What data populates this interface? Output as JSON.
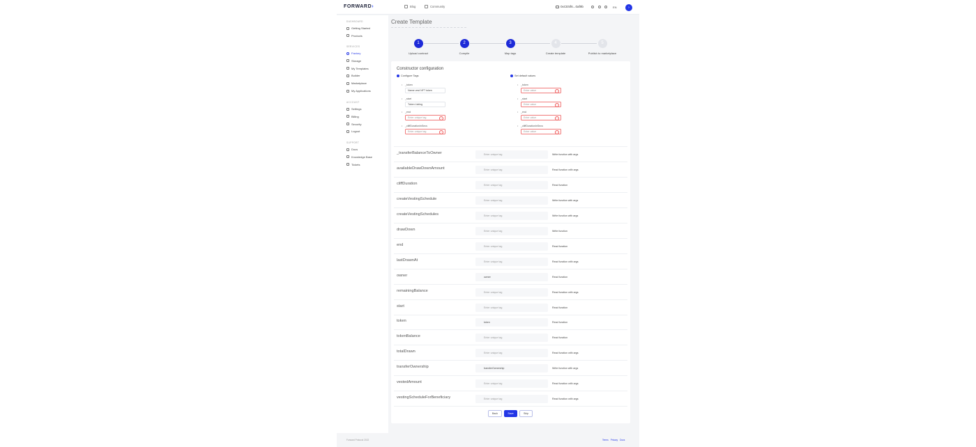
{
  "header": {
    "logo": "FORWARD",
    "nav": [
      {
        "label": "Blog",
        "icon": "book-icon"
      },
      {
        "label": "Community",
        "icon": "chat-icon"
      }
    ],
    "wallet": "0xCE5f6...0af9b",
    "language": "EN"
  },
  "sidebar": {
    "sections": [
      {
        "label": "DASHBOARD",
        "items": [
          {
            "label": "Getting Started",
            "icon": "rocket-icon",
            "active": false
          },
          {
            "label": "Products",
            "icon": "box-icon",
            "active": false
          }
        ]
      },
      {
        "label": "SERVICES",
        "items": [
          {
            "label": "Factory",
            "icon": "factory-icon",
            "active": true
          },
          {
            "label": "Storage",
            "icon": "storage-icon",
            "active": false
          },
          {
            "label": "My Templates",
            "icon": "template-icon",
            "active": false
          },
          {
            "label": "Builder",
            "icon": "builder-icon",
            "active": false
          },
          {
            "label": "Marketplace",
            "icon": "marketplace-icon",
            "active": false
          },
          {
            "label": "My Applications",
            "icon": "apps-icon",
            "active": false
          }
        ]
      },
      {
        "label": "ACCOUNT",
        "items": [
          {
            "label": "Settings",
            "icon": "gear-icon",
            "active": false
          },
          {
            "label": "Billing",
            "icon": "billing-icon",
            "active": false
          },
          {
            "label": "Security",
            "icon": "shield-icon",
            "active": false
          },
          {
            "label": "Logout",
            "icon": "logout-icon",
            "active": false
          }
        ]
      },
      {
        "label": "SUPPORT",
        "items": [
          {
            "label": "Docs",
            "icon": "docs-icon",
            "active": false
          },
          {
            "label": "Knowledge Base",
            "icon": "knowledge-icon",
            "active": false
          },
          {
            "label": "Tickets",
            "icon": "ticket-icon",
            "active": false
          }
        ]
      }
    ]
  },
  "page": {
    "title": "Create Template"
  },
  "steps": [
    {
      "number": "1",
      "label": "Upload contract",
      "state": "done"
    },
    {
      "number": "2",
      "label": "Compile",
      "state": "done"
    },
    {
      "number": "3",
      "label": "Map tags",
      "state": "done"
    },
    {
      "number": "4",
      "label": "Create template",
      "state": "todo"
    },
    {
      "number": "5",
      "label": "Publish to marketplace",
      "state": "todo"
    }
  ],
  "constructor": {
    "title": "Constructor configuration",
    "configure_tags_label": "Configure Tags",
    "default_values_label": "Set default values",
    "tags": [
      {
        "name": "_token",
        "value": "Name vest NFT token",
        "error": false
      },
      {
        "name": "_start",
        "value": "Token Listing",
        "error": false
      },
      {
        "name": "_end",
        "value": "",
        "placeholder": "Enter unique tag",
        "error": true
      },
      {
        "name": "_cliffDurationInSecs",
        "value": "",
        "placeholder": "Enter unique tag",
        "error": true
      }
    ],
    "defaults": [
      {
        "name": "_token",
        "placeholder": "Enter value"
      },
      {
        "name": "_start",
        "placeholder": "Enter value"
      },
      {
        "name": "_end",
        "placeholder": "Enter value"
      },
      {
        "name": "_cliffDurationInSecs",
        "placeholder": "Enter value"
      }
    ]
  },
  "functions": [
    {
      "name": "_transferBalanceToOwner",
      "tag": "",
      "type": "Write function with args"
    },
    {
      "name": "availableDrawDownAmount",
      "tag": "",
      "type": "Read function with args"
    },
    {
      "name": "cliffDuration",
      "tag": "",
      "type": "Read function"
    },
    {
      "name": "createVestingSchedule",
      "tag": "",
      "type": "Write function with args"
    },
    {
      "name": "createVestingSchedules",
      "tag": "",
      "type": "Write function with args"
    },
    {
      "name": "drawDown",
      "tag": "",
      "type": "Write function"
    },
    {
      "name": "end",
      "tag": "",
      "type": "Read function"
    },
    {
      "name": "lastDrawnAt",
      "tag": "",
      "type": "Read function with args"
    },
    {
      "name": "owner",
      "tag": "owner",
      "type": "Read function"
    },
    {
      "name": "remainingBalance",
      "tag": "",
      "type": "Read function with args"
    },
    {
      "name": "start",
      "tag": "",
      "type": "Read function"
    },
    {
      "name": "token",
      "tag": "token",
      "type": "Read function"
    },
    {
      "name": "tokenBalance",
      "tag": "",
      "type": "Read function"
    },
    {
      "name": "totalDrawn",
      "tag": "",
      "type": "Read function with args"
    },
    {
      "name": "transferOwnership",
      "tag": "transferOwnership",
      "type": "Write function with args"
    },
    {
      "name": "vestedAmount",
      "tag": "",
      "type": "Read function with args"
    },
    {
      "name": "vestingScheduleForBeneficiary",
      "tag": "",
      "type": "Read function with args"
    }
  ],
  "tag_placeholder": "Enter unique tag",
  "buttons": {
    "back": "Back",
    "save": "Save",
    "skip": "Skip"
  },
  "footer": {
    "copyright": "Forward Protocol 2022",
    "links": [
      "Terms",
      "Privacy",
      "Docs"
    ]
  },
  "colors": {
    "accent": "#2336e6",
    "error": "#f07a7a"
  }
}
